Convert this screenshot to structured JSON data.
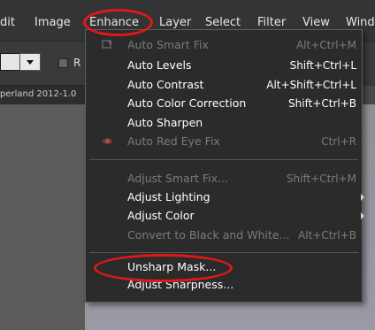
{
  "menubar": {
    "items": [
      "dit",
      "Image",
      "Enhance",
      "Layer",
      "Select",
      "Filter",
      "View",
      "Wind"
    ]
  },
  "toolbar": {
    "checkbox_label": "R"
  },
  "document": {
    "tab_label": "perland 2012-1.0"
  },
  "enhance_menu": {
    "items": [
      {
        "label": "Auto Smart Fix",
        "shortcut": "Alt+Ctrl+M",
        "enabled": false,
        "icon": "auto-smart-fix-icon"
      },
      {
        "label": "Auto Levels",
        "shortcut": "Shift+Ctrl+L",
        "enabled": true
      },
      {
        "label": "Auto Contrast",
        "shortcut": "Alt+Shift+Ctrl+L",
        "enabled": true
      },
      {
        "label": "Auto Color Correction",
        "shortcut": "Shift+Ctrl+B",
        "enabled": true
      },
      {
        "label": "Auto Sharpen",
        "shortcut": "",
        "enabled": true
      },
      {
        "label": "Auto Red Eye Fix",
        "shortcut": "Ctrl+R",
        "enabled": false,
        "icon": "red-eye-icon"
      },
      {
        "label": "Adjust Smart Fix...",
        "shortcut": "Shift+Ctrl+M",
        "enabled": false
      },
      {
        "label": "Adjust Lighting",
        "shortcut": "",
        "enabled": true,
        "submenu": true
      },
      {
        "label": "Adjust Color",
        "shortcut": "",
        "enabled": true,
        "submenu": true
      },
      {
        "label": "Convert to Black and White...",
        "shortcut": "Alt+Ctrl+B",
        "enabled": false
      },
      {
        "label": "Unsharp Mask...",
        "shortcut": "",
        "enabled": true
      },
      {
        "label": "Adjust Sharpness...",
        "shortcut": "",
        "enabled": true
      }
    ]
  },
  "colors": {
    "highlight_ring": "#e01818",
    "menu_bg": "#2b2b2b",
    "menubar_bg": "#343434"
  }
}
